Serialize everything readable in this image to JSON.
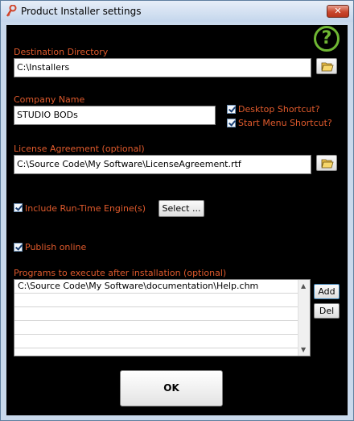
{
  "window": {
    "title": "Product Installer settings",
    "close_glyph": "✕"
  },
  "help": {
    "glyph": "?",
    "icon": "help-icon",
    "color": "#6fb733"
  },
  "destination": {
    "label": "Destination Directory",
    "value": "C:\\Installers",
    "browse_icon": "folder-open-icon"
  },
  "company": {
    "label": "Company Name",
    "value": "STUDIO BODs"
  },
  "shortcuts": {
    "desktop": {
      "label": "Desktop Shortcut?",
      "checked": true
    },
    "start_menu": {
      "label": "Start Menu Shortcut?",
      "checked": true
    }
  },
  "license": {
    "label": "License Agreement (optional)",
    "value": "C:\\Source Code\\My Software\\LicenseAgreement.rtf",
    "browse_icon": "folder-open-icon"
  },
  "runtime": {
    "label": "Include Run-Time Engine(s)",
    "checked": true,
    "select_button": "Select ..."
  },
  "publish": {
    "label": "Publish online",
    "checked": true
  },
  "programs": {
    "label": "Programs to execute after installation (optional)",
    "rows": [
      "C:\\Source Code\\My Software\\documentation\\Help.chm",
      "",
      "",
      "",
      ""
    ],
    "add_button": "Add",
    "del_button": "Del"
  },
  "ok_button": "OK",
  "colors": {
    "label": "#e05a2c",
    "background": "#000000",
    "accent": "#6fb733"
  }
}
